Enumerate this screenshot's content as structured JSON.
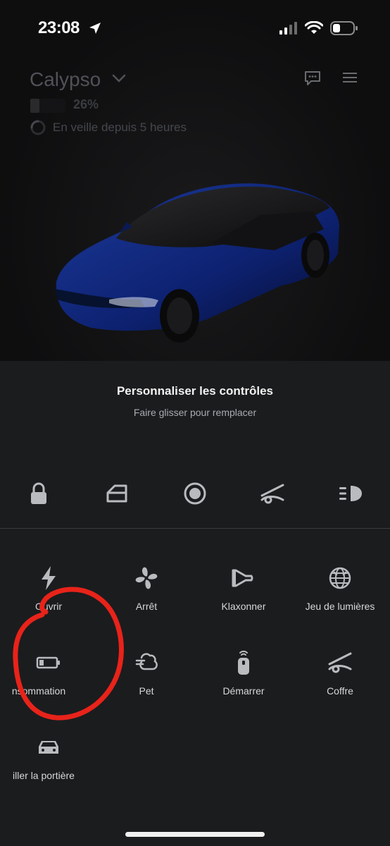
{
  "status_bar": {
    "time": "23:08"
  },
  "header": {
    "car_name": "Calypso",
    "battery_percent": "26%",
    "battery_level": 0.26,
    "standby_text": "En veille depuis 5 heures"
  },
  "customize": {
    "title": "Personnaliser les contrôles",
    "subtitle": "Faire glisser pour remplacer"
  },
  "favorites": [
    "lock-icon",
    "door-icon",
    "record-icon",
    "trunk-icon",
    "headlights-icon"
  ],
  "controls": [
    {
      "label": "Ouvrir",
      "icon": "lightning-icon"
    },
    {
      "label": "Arrêt",
      "icon": "fan-icon"
    },
    {
      "label": "Klaxonner",
      "icon": "horn-icon"
    },
    {
      "label": "Jeu de lumières",
      "icon": "light-show-icon"
    },
    {
      "label": "nsommation",
      "icon": "battery-icon"
    },
    {
      "label": "Pet",
      "icon": "fart-icon"
    },
    {
      "label": "Démarrer",
      "icon": "key-fob-icon"
    },
    {
      "label": "Coffre",
      "icon": "trunk-icon"
    },
    {
      "label": "iller la portière",
      "icon": "car-lock-icon"
    }
  ],
  "colors": {
    "background": "#1b1c1e",
    "car_paint": "#0f2a7a",
    "annotation": "#e8231a"
  }
}
